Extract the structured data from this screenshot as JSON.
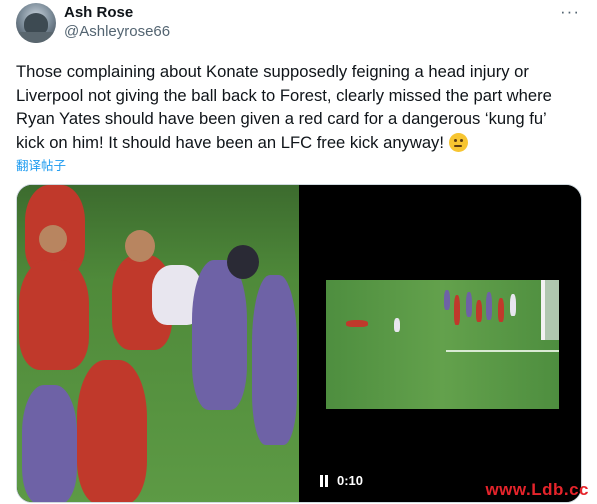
{
  "author": {
    "name": "Ash Rose",
    "handle": "@Ashleyrose66",
    "avatar_icon": "avatar-photo"
  },
  "menu_icon": "more-horizontal-icon",
  "tweet": {
    "text": "Those complaining about Konate supposedly feigning a head injury or\nLiverpool not giving the ball back to Forest, clearly missed the part where\nRyan Yates should have been given a red card for a dangerous ‘kung fu’\nkick on him!  It should have been an LFC free kick anyway! ",
    "emoji": "thinking-face-emoji",
    "translate_label": "翻译帖子"
  },
  "video": {
    "time": "0:10",
    "control_icon": "pause-icon"
  },
  "watermark": "www.Ldb.cc",
  "colors": {
    "link": "#1d9bf0",
    "text": "#0f1419",
    "secondary": "#536471",
    "watermark": "#e5242b"
  }
}
